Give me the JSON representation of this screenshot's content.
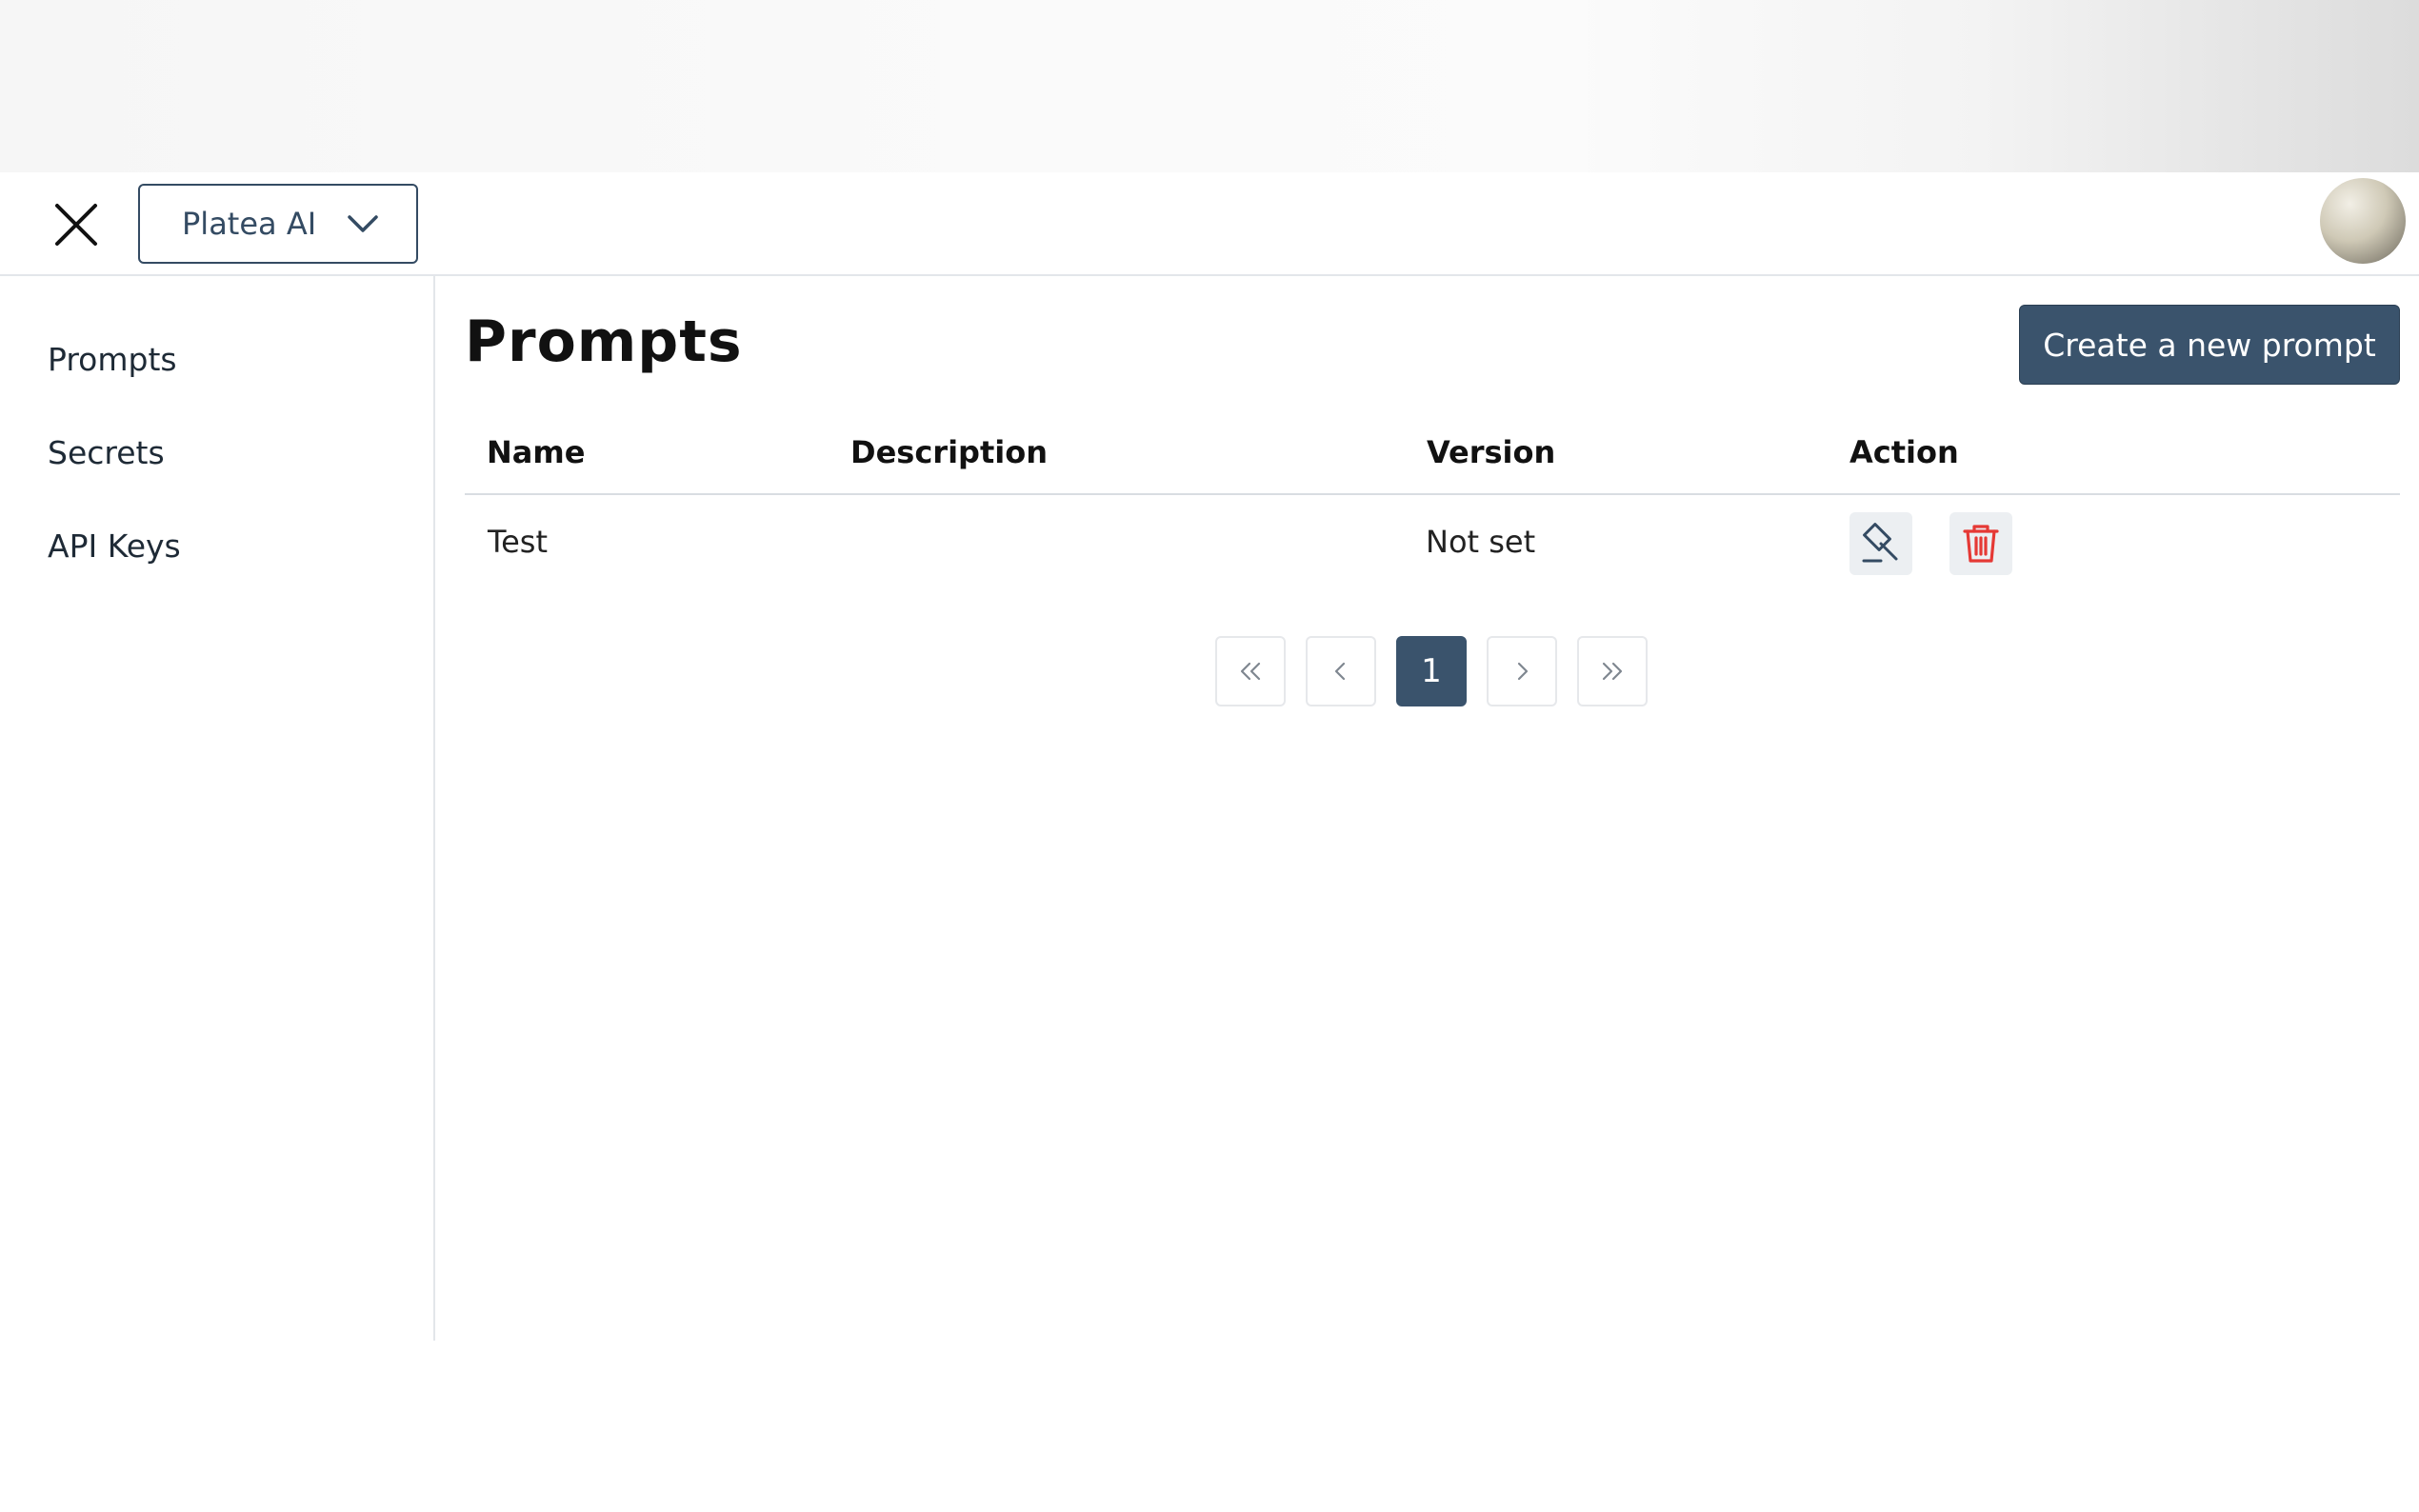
{
  "header": {
    "organization": "Platea AI"
  },
  "sidebar": {
    "items": [
      {
        "label": "Prompts"
      },
      {
        "label": "Secrets"
      },
      {
        "label": "API Keys"
      }
    ]
  },
  "main": {
    "title": "Prompts",
    "create_button_label": "Create a new prompt",
    "table": {
      "columns": [
        "Name",
        "Description",
        "Version",
        "Action"
      ],
      "rows": [
        {
          "name": "Test",
          "description": "",
          "version": "Not set"
        }
      ]
    },
    "pagination": {
      "current_page": "1"
    }
  },
  "colors": {
    "primary": "#3a536c",
    "delete_icon": "#e53935",
    "border": "#e3e6ea"
  },
  "icons": {
    "close": "close-icon",
    "dropdown": "chevron-down-icon",
    "edit": "hammer-icon",
    "delete": "trash-icon",
    "first": "double-chevron-left-icon",
    "prev": "chevron-left-icon",
    "next": "chevron-right-icon",
    "last": "double-chevron-right-icon"
  }
}
